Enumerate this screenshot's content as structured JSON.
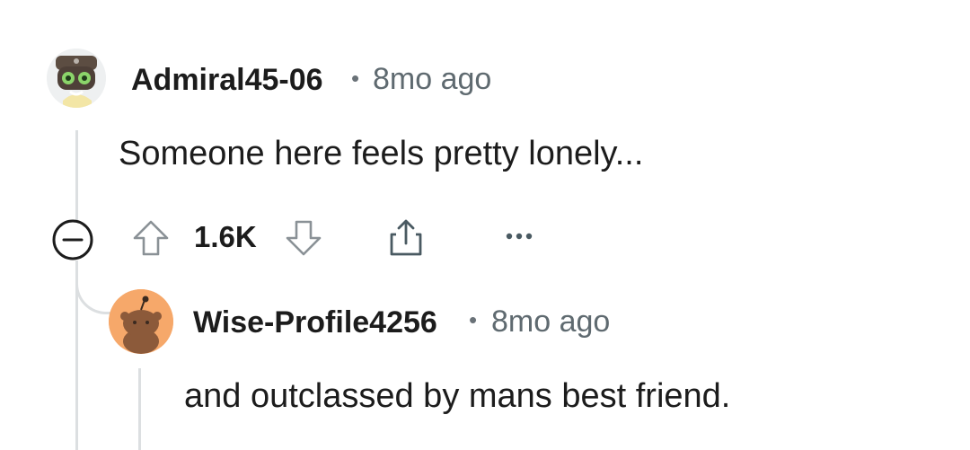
{
  "comment": {
    "username": "Admiral45-06",
    "separator": "•",
    "time": "8mo ago",
    "body": "Someone here feels pretty lonely...",
    "score": "1.6K",
    "avatar_icon": "robot-avatar-icon"
  },
  "reply": {
    "username": "Wise-Profile4256",
    "separator": "•",
    "time": "8mo ago",
    "body": "and outclassed by mans best friend.",
    "avatar_icon": "snoo-avatar-icon",
    "avatar_color": "#f6a86a"
  },
  "actions": {
    "collapse_icon": "collapse-minus-icon",
    "upvote_icon": "upvote-arrow-icon",
    "downvote_icon": "downvote-arrow-icon",
    "share_icon": "share-icon",
    "more_icon": "more-dots-icon"
  },
  "colors": {
    "text": "#1c1c1c",
    "meta": "#5f6a70",
    "thread_line": "#dcdfe1"
  }
}
